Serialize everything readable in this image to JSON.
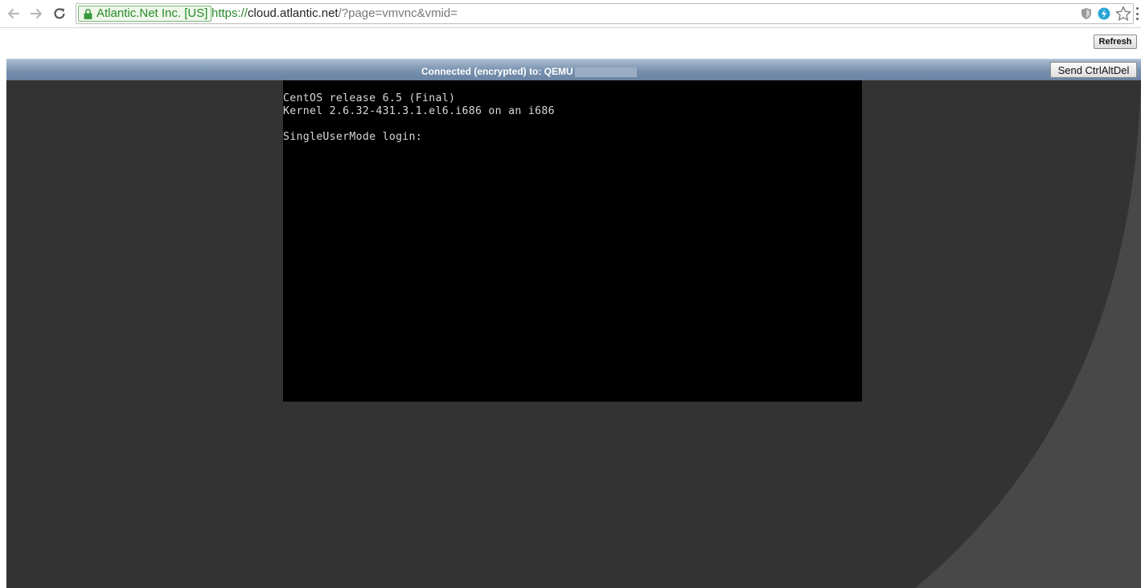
{
  "browser": {
    "ev_badge": "Atlantic.Net Inc. [US]",
    "url_scheme": "https://",
    "url_host": "cloud.atlantic.net",
    "url_path": "/?page=vmvnc&vmid=",
    "icons": [
      "back-arrow-icon",
      "forward-arrow-icon",
      "reload-icon",
      "lock-icon",
      "shield-icon",
      "extension-bolt-icon",
      "bookmark-star-icon",
      "menu-icon"
    ],
    "colors": {
      "secure": "#2a8a2a",
      "badge_bg": "#eef7ea"
    }
  },
  "page": {
    "refresh_label": "Refresh"
  },
  "vnc": {
    "status": "Connected (encrypted) to: QEMU",
    "send_ctrlaltdel_label": "Send CtrlAltDel",
    "colors": {
      "status_bar": "#7790ad",
      "frame_bg": "#333333",
      "console_bg": "#000000",
      "console_text": "#d8d8d8"
    }
  },
  "console": {
    "lines": [
      "CentOS release 6.5 (Final)",
      "Kernel 2.6.32-431.3.1.el6.i686 on an i686",
      "",
      "SingleUserMode login:"
    ]
  }
}
